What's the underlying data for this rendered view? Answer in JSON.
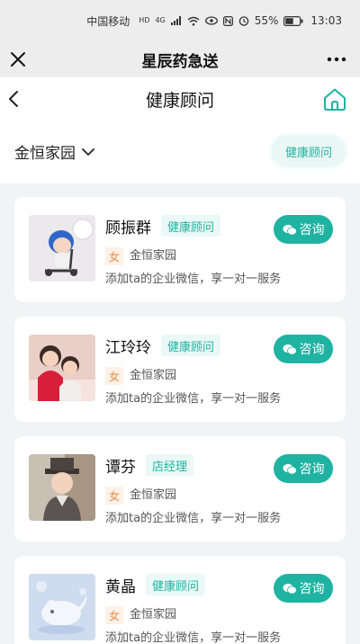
{
  "status_bar": {
    "carrier": "中国移动",
    "hd": "HD",
    "network": "4G",
    "battery": "55%",
    "time": "13:03"
  },
  "wechat_bar": {
    "title": "星辰药急送"
  },
  "header": {
    "title": "健康顾问"
  },
  "filter": {
    "community": "金恒家园",
    "role_chip": "健康顾问"
  },
  "colors": {
    "accent": "#1fb3a1",
    "accent_light": "#eaf8f6",
    "gender_bg": "#fdf1e8",
    "gender_fg": "#e58a43"
  },
  "consult_label": "咨询",
  "advisors": [
    {
      "name": "顾振群",
      "role": "健康顾问",
      "gender": "女",
      "community": "金恒家园",
      "desc": "添加ta的企业微信，享一对一服务",
      "avatar": "cartoon-scooter-kid"
    },
    {
      "name": "江玲玲",
      "role": "健康顾问",
      "gender": "女",
      "community": "金恒家园",
      "desc": "添加ta的企业微信，享一对一服务",
      "avatar": "two-children-photo"
    },
    {
      "name": "谭芬",
      "role": "店经理",
      "gender": "女",
      "community": "金恒家园",
      "desc": "添加ta的企业微信，享一对一服务",
      "avatar": "child-in-hat-photo"
    },
    {
      "name": "黄晶",
      "role": "健康顾问",
      "gender": "女",
      "community": "金恒家园",
      "desc": "添加ta的企业微信，享一对一服务",
      "avatar": "whale-illustration"
    }
  ]
}
